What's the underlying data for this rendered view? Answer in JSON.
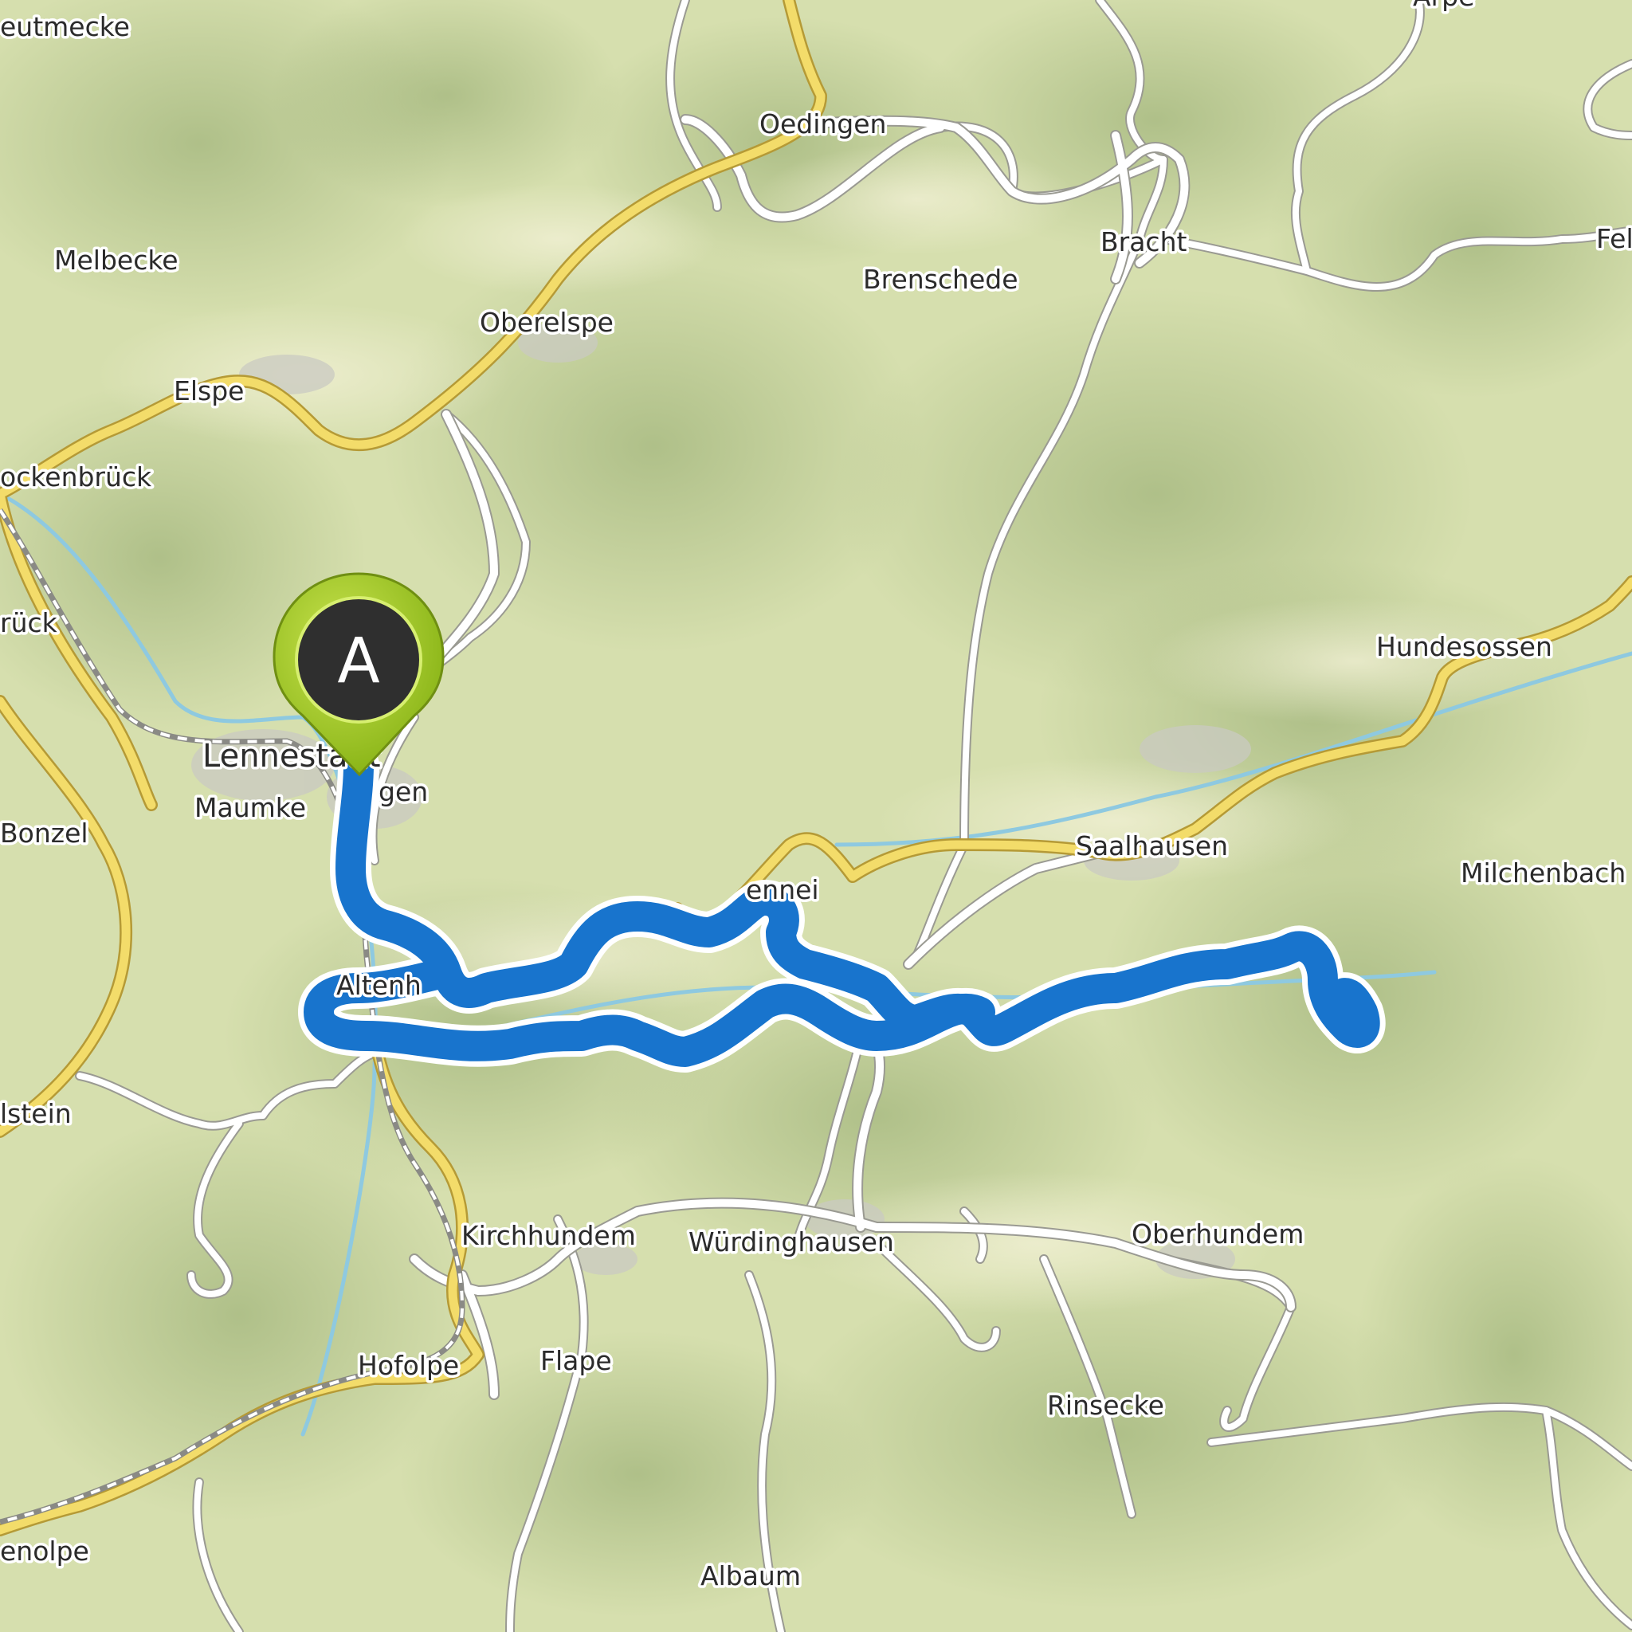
{
  "map": {
    "route_color": "#1874cd",
    "marker_color": "#95c21b",
    "start_marker": {
      "label": "A"
    },
    "places": [
      {
        "id": "eutmecke",
        "name": "eutmecke"
      },
      {
        "id": "arpe",
        "name": "Arpe"
      },
      {
        "id": "oedingen",
        "name": "Oedingen"
      },
      {
        "id": "melbecke",
        "name": "Melbecke"
      },
      {
        "id": "bracht",
        "name": "Bracht"
      },
      {
        "id": "fel",
        "name": "Fel"
      },
      {
        "id": "brenschede",
        "name": "Brenschede"
      },
      {
        "id": "oberelspe",
        "name": "Oberelspe"
      },
      {
        "id": "elspe",
        "name": "Elspe"
      },
      {
        "id": "ockenbrueck",
        "name": "ockenbrück"
      },
      {
        "id": "brueck",
        "name": "rück"
      },
      {
        "id": "hundesossen",
        "name": "Hundesossen"
      },
      {
        "id": "lennestadt",
        "name": "Lennestadt"
      },
      {
        "id": "maumke",
        "name": "Maumke"
      },
      {
        "id": "gen",
        "name": "gen"
      },
      {
        "id": "bonzel",
        "name": "Bonzel"
      },
      {
        "id": "saalhausen",
        "name": "Saalhausen"
      },
      {
        "id": "milchenbach",
        "name": "Milchenbach"
      },
      {
        "id": "lennei",
        "name": "ennei"
      },
      {
        "id": "altenh",
        "name": "Altenh"
      },
      {
        "id": "lstein",
        "name": "lstein"
      },
      {
        "id": "kirchhundem",
        "name": "Kirchhundem"
      },
      {
        "id": "wuerdinghausen",
        "name": "Würdinghausen"
      },
      {
        "id": "oberhundem",
        "name": "Oberhundem"
      },
      {
        "id": "hofolpe",
        "name": "Hofolpe"
      },
      {
        "id": "flape",
        "name": "Flape"
      },
      {
        "id": "rinsecke",
        "name": "Rinsecke"
      },
      {
        "id": "enolpe",
        "name": "enolpe"
      },
      {
        "id": "albaum",
        "name": "Albaum"
      }
    ]
  }
}
